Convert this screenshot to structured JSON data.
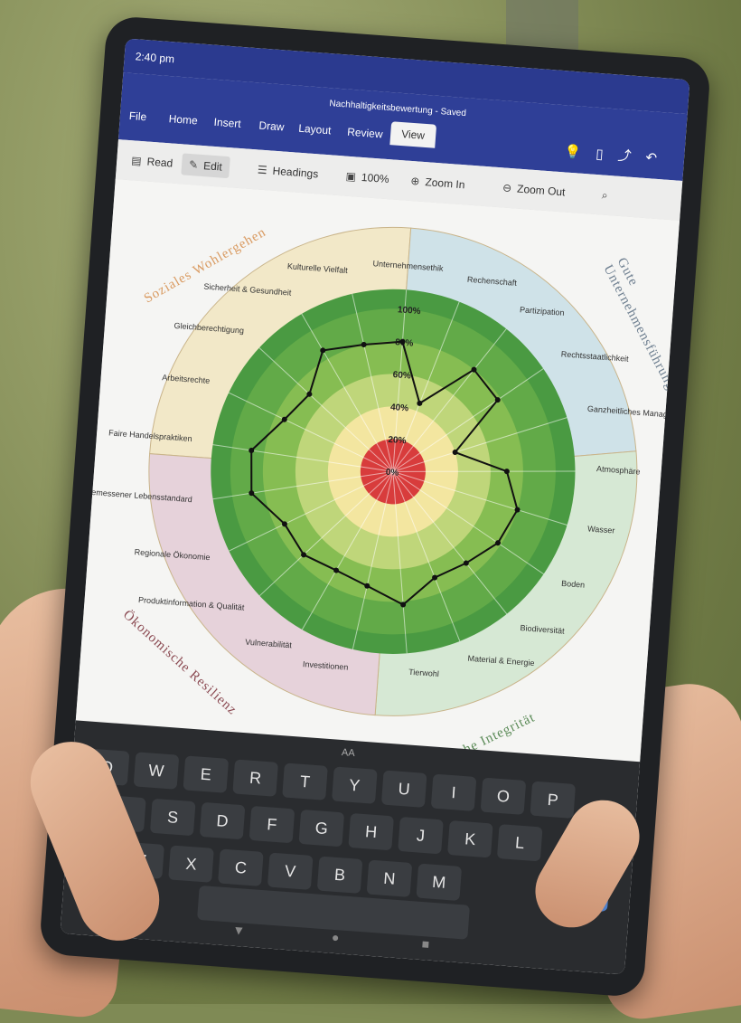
{
  "status": {
    "time": "2:40 pm"
  },
  "doc_title": "Nachhaltigkeitsbewertung - Saved",
  "ribbon_tabs": [
    "File",
    "Home",
    "Insert",
    "Draw",
    "Layout",
    "Review",
    "View"
  ],
  "toolbar": {
    "read": "Read",
    "edit": "Edit",
    "headings": "Headings",
    "zoom_level": "100%",
    "zoom_in": "Zoom In",
    "zoom_out": "Zoom Out"
  },
  "chart_data": {
    "type": "radar",
    "categories_groups": [
      {
        "name": "Soziales Wohlergehen",
        "color": "#f2e8c8"
      },
      {
        "name": "Gute Unternehmensführung",
        "color": "#cfe2e8"
      },
      {
        "name": "Ökologische Integrität",
        "color": "#d6e8d4"
      },
      {
        "name": "Ökonomische Resilienz",
        "color": "#e6d2da"
      }
    ],
    "ring_labels": [
      "0%",
      "20%",
      "40%",
      "60%",
      "80%",
      "100%"
    ],
    "axes": [
      "Unternehmensethik",
      "Rechenschaft",
      "Partizipation",
      "Rechtsstaatlichkeit",
      "Ganzheitliches Management",
      "Atmosphäre",
      "Wasser",
      "Boden",
      "Biodiversität",
      "Material & Energie",
      "Tierwohl",
      "Investitionen",
      "Vulnerabilität",
      "Produktinformation & Qualität",
      "Regionale Ökonomie",
      "Angemessener Lebensstandard",
      "Faire Handelspraktiken",
      "Arbeitsrechte",
      "Gleichberechtigung",
      "Sicherheit & Gesundheit",
      "Kulturelle Vielfalt"
    ],
    "series": [
      {
        "values": [
          80,
          45,
          80,
          78,
          40,
          70,
          80,
          78,
          72,
          70,
          82,
          72,
          70,
          75,
          74,
          88,
          88,
          74,
          70,
          86,
          80
        ]
      }
    ]
  },
  "keyboard": {
    "label": "AA",
    "row1": [
      "Q",
      "W",
      "E",
      "R",
      "T",
      "Y",
      "U",
      "I",
      "O",
      "P"
    ],
    "row2": [
      "A",
      "S",
      "D",
      "F",
      "G",
      "H",
      "J",
      "K",
      "L"
    ],
    "row3": [
      "Z",
      "X",
      "C",
      "V",
      "B",
      "N",
      "M"
    ]
  }
}
